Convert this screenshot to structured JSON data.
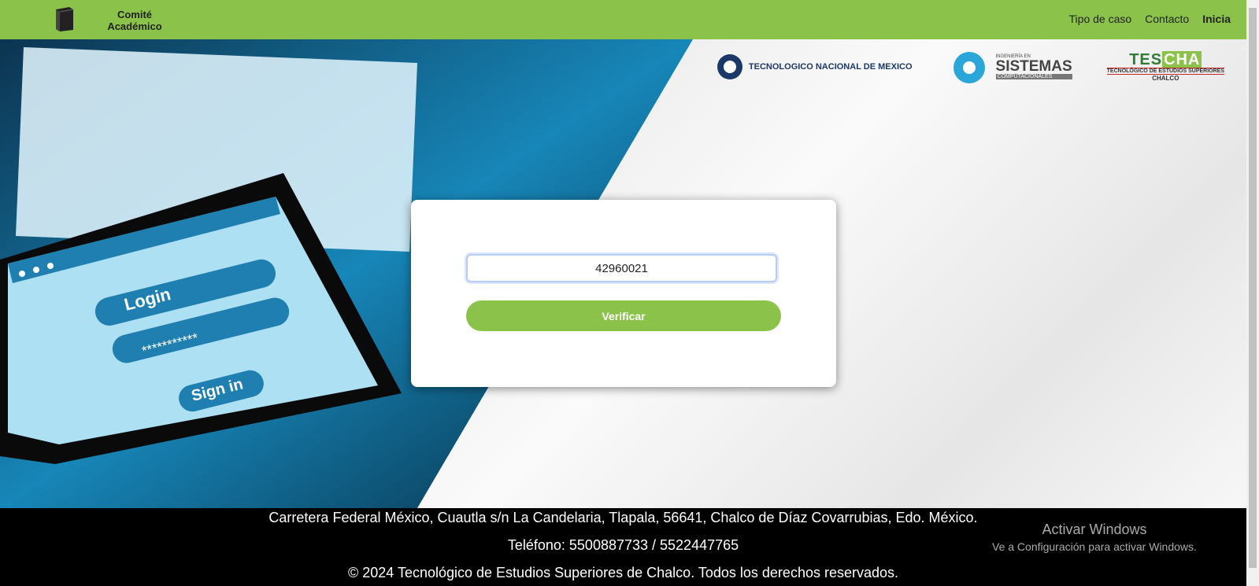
{
  "navbar": {
    "brand_line1": "Comité",
    "brand_line2": "Académico",
    "links": [
      "Tipo de caso",
      "Contacto",
      "Inicia"
    ]
  },
  "hero": {
    "logos": {
      "tecnm": "TECNOLOGICO NACIONAL DE MEXICO",
      "sistemas_top": "INGENIERÍA EN",
      "sistemas": "SISTEMAS",
      "sistemas_sub": "COMPUTACIONALES",
      "tescha_tes": "TES",
      "tescha_cha": "CHA",
      "tescha_line": "TECNOLÓGICO DE ESTUDIOS SUPERIORES",
      "tescha_city": "CHALCO"
    },
    "tablet": {
      "login": "Login",
      "password": "***********",
      "signin": "Sign in"
    }
  },
  "form": {
    "code_value": "42960021",
    "verify_label": "Verificar"
  },
  "footer": {
    "address": "Carretera Federal México, Cuautla s/n La Candelaria, Tlapala, 56641, Chalco de Díaz Covarrubias, Edo. México.",
    "phone": "Teléfono: 5500887733 / 5522447765",
    "copyright": "© 2024 Tecnológico de Estudios Superiores de Chalco. Todos los derechos reservados."
  },
  "watermark": {
    "title": "Activar Windows",
    "subtitle": "Ve a Configuración para activar Windows."
  },
  "colors": {
    "accent": "#8bc34a",
    "footer": "#000000",
    "tablet_blue": "#1e7fb0"
  }
}
